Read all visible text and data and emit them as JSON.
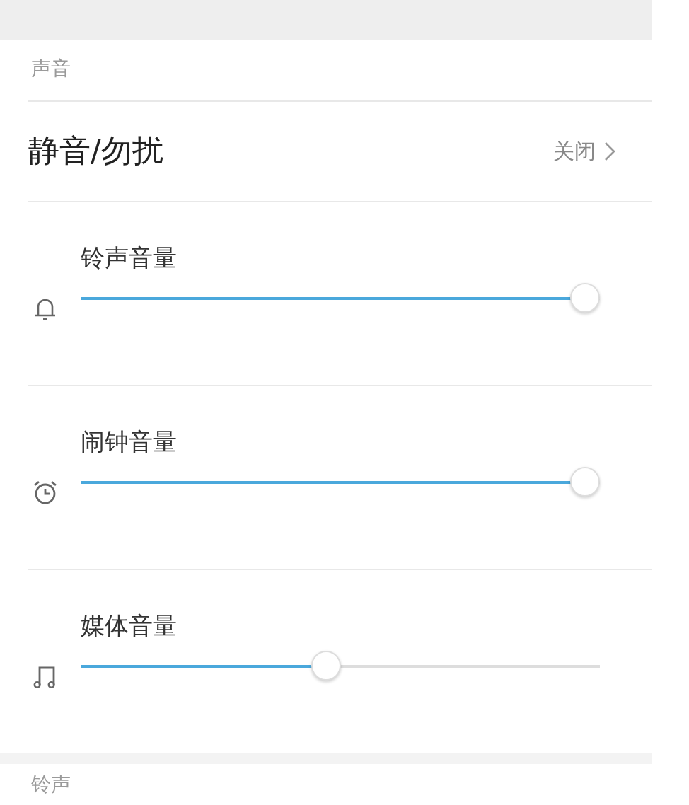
{
  "sections": [
    {
      "title": "声音",
      "items": [
        {
          "kind": "link",
          "label": "静音/勿扰",
          "value": "关闭"
        },
        {
          "kind": "slider",
          "label": "铃声音量",
          "level": 1
        },
        {
          "kind": "slider",
          "label": "闹钟音量",
          "level": 1
        },
        {
          "kind": "slider",
          "label": "媒体音量",
          "level": 0.47
        }
      ]
    },
    {
      "title": "铃声"
    }
  ]
}
